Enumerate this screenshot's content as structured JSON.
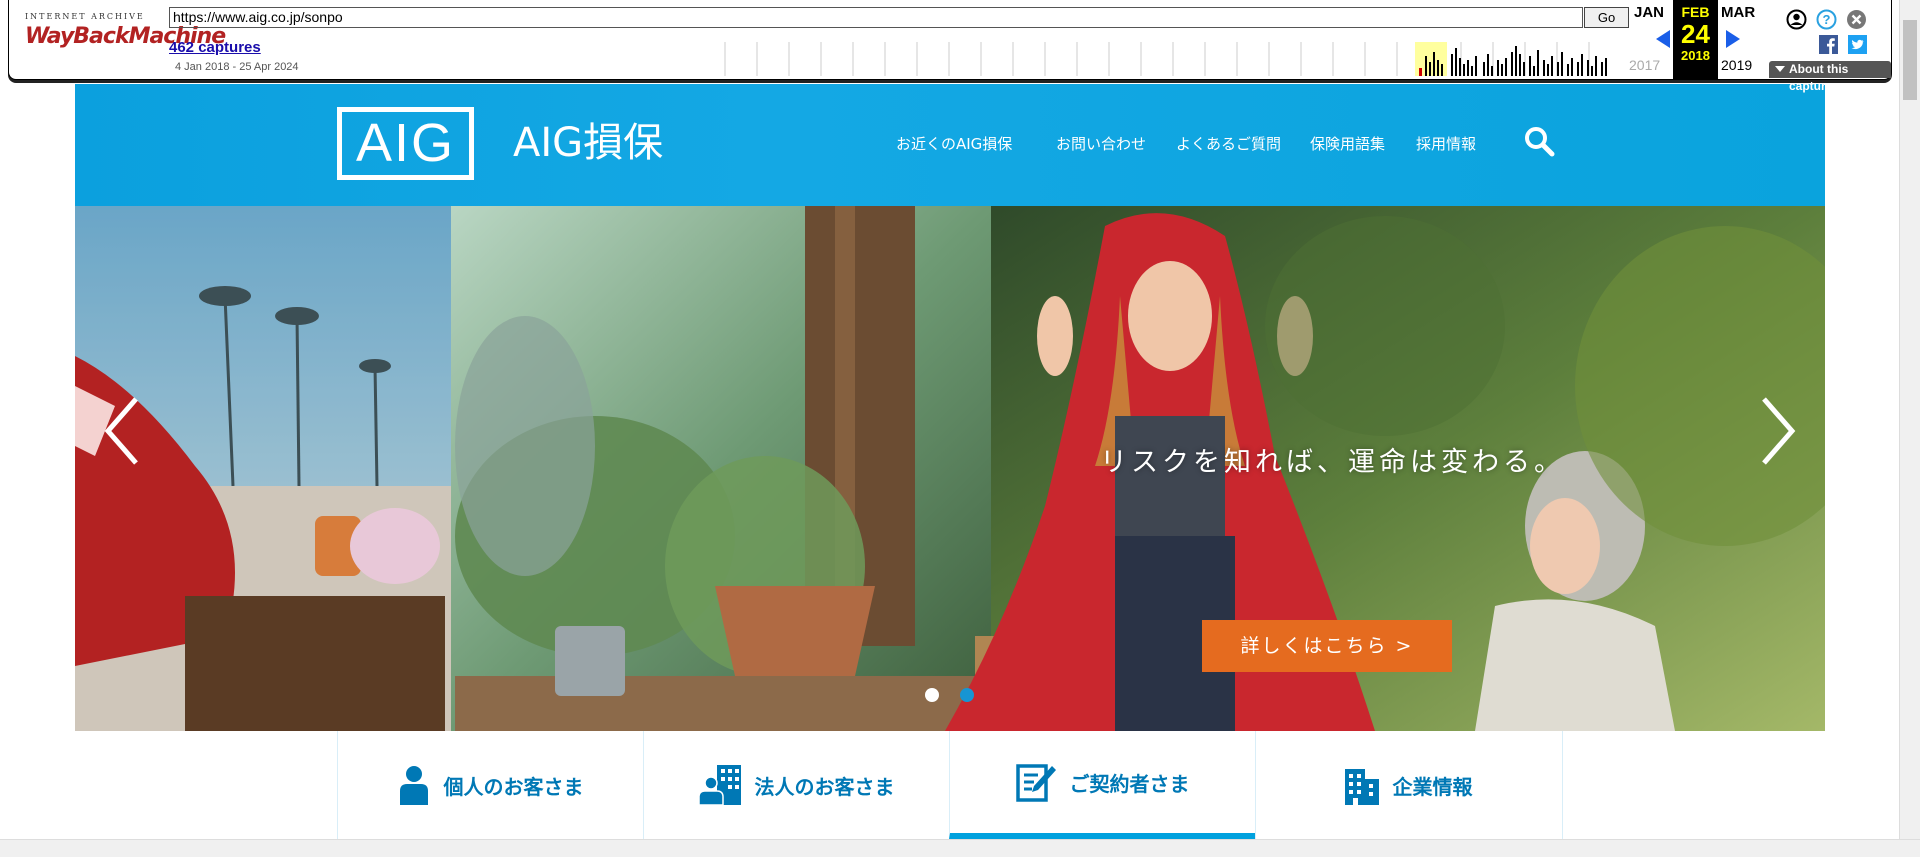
{
  "wayback": {
    "logo_top": "INTERNET ARCHIVE",
    "logo_main": "WayBackMachine",
    "url": "https://www.aig.co.jp/sonpo",
    "go_label": "Go",
    "captures": "462 captures",
    "range": "4 Jan 2018 - 25 Apr 2024",
    "prev_month": "JAN",
    "prev_year": "2017",
    "cur_month": "FEB",
    "cur_day": "24",
    "cur_year": "2018",
    "next_month": "MAR",
    "next_year": "2019",
    "about": "About this capture"
  },
  "header": {
    "logo": "AIG",
    "brand": "AIG損保",
    "nav": [
      "お近くのAIG損保",
      "お問い合わせ",
      "よくあるご質問",
      "保険用語集",
      "採用情報"
    ]
  },
  "hero": {
    "caption": "リスクを知れば、運命は変わる。",
    "cta": "詳しくはこちら >",
    "slide_count": 2,
    "active_slide": 2
  },
  "tabs": [
    {
      "label": "個人のお客さま",
      "icon": "person-icon"
    },
    {
      "label": "法人のお客さま",
      "icon": "business-person-icon"
    },
    {
      "label": "ご契約者さま",
      "icon": "contract-edit-icon"
    },
    {
      "label": "企業情報",
      "icon": "building-icon"
    }
  ],
  "active_tab": 2,
  "colors": {
    "header_blue": "#0ba0de",
    "cta_orange": "#e56b1f",
    "tab_text": "#0078b5",
    "tab_active_underline": "#00a1de"
  }
}
